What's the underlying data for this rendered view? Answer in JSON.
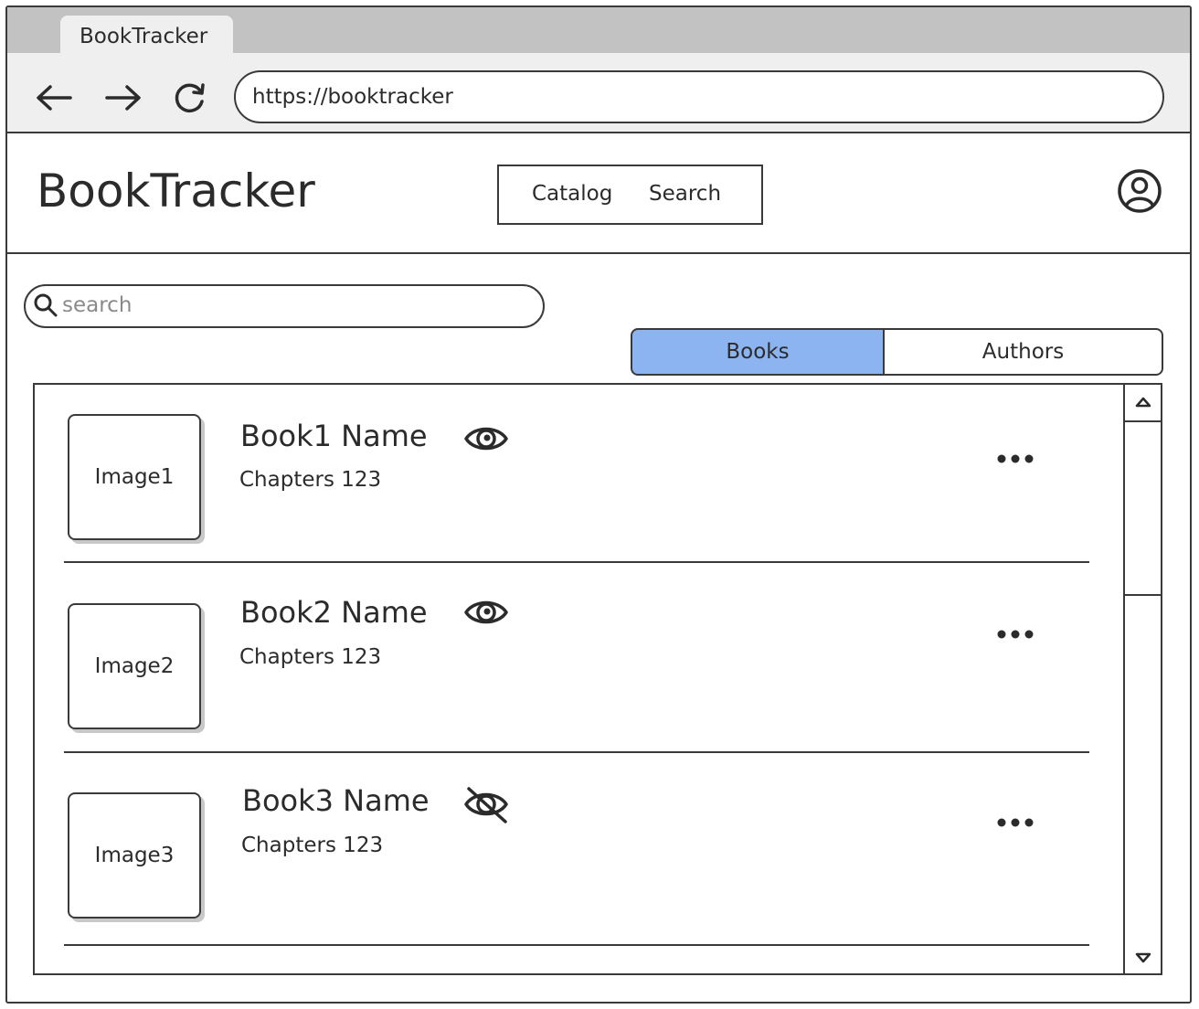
{
  "browser": {
    "tab_title": "BookTracker",
    "url": "https://booktracker",
    "back_icon": "arrow-left-icon",
    "forward_icon": "arrow-right-icon",
    "reload_icon": "reload-icon"
  },
  "header": {
    "app_title": "BookTracker",
    "nav": [
      {
        "label": "Catalog"
      },
      {
        "label": "Search"
      }
    ],
    "user_icon": "user-circle-icon"
  },
  "search": {
    "placeholder": "search",
    "value": ""
  },
  "tabs": {
    "items": [
      {
        "label": "Books",
        "selected": true
      },
      {
        "label": "Authors",
        "selected": false
      }
    ],
    "accent": "#8cb4f0"
  },
  "books": [
    {
      "image": "Image1",
      "name": "Book1 Name",
      "chapters": "Chapters 123",
      "visibility_icon": "eye-icon"
    },
    {
      "image": "Image2",
      "name": "Book2 Name",
      "chapters": "Chapters 123",
      "visibility_icon": "eye-icon"
    },
    {
      "image": "Image3",
      "name": "Book3 Name",
      "chapters": "Chapters 123",
      "visibility_icon": "eye-off-icon"
    }
  ]
}
